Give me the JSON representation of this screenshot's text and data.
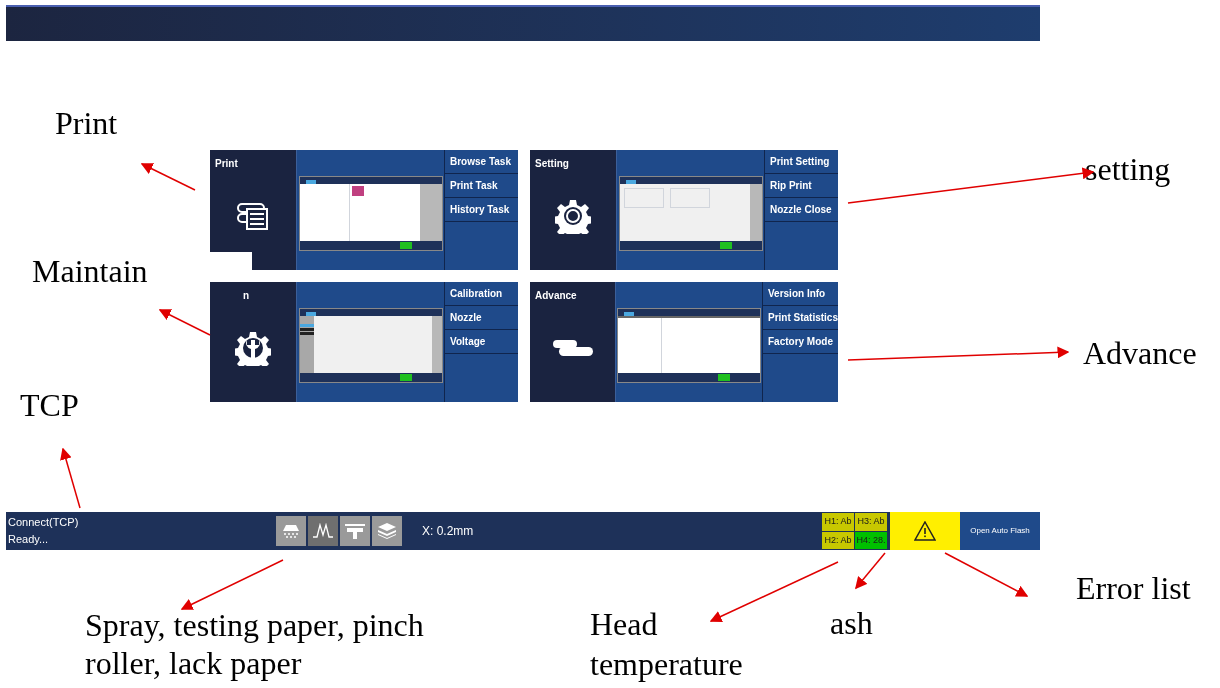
{
  "tiles": [
    {
      "title": "Print",
      "menu": [
        "Browse Task",
        "Print Task",
        "History Task"
      ]
    },
    {
      "title": "Setting",
      "menu": [
        "Print Setting",
        "Rip Print",
        "Nozzle Close"
      ]
    },
    {
      "title": "n",
      "menu": [
        "Calibration",
        "Nozzle",
        "Voltage"
      ]
    },
    {
      "title": "Advance",
      "menu": [
        "Version Info",
        "Print Statistics",
        "Factory Mode"
      ]
    }
  ],
  "status_bar": {
    "connection": "Connect(TCP)",
    "state": "Ready...",
    "sensors": [
      {
        "kind": "spray",
        "active": false
      },
      {
        "kind": "wave",
        "active": true
      },
      {
        "kind": "roller",
        "active": false
      },
      {
        "kind": "paper",
        "active": false
      }
    ],
    "position": "X: 0.2mm",
    "heads": [
      {
        "label": "H1: Ab",
        "color": "#c8c800"
      },
      {
        "label": "H2: Ab",
        "color": "#c8c800"
      },
      {
        "label": "H3: Ab",
        "color": "#c8c800"
      },
      {
        "label": "H4: 28.",
        "color": "#00c000"
      }
    ],
    "flash_button": "Open Auto Flash"
  },
  "annotations": [
    "Print",
    "setting",
    "Maintain",
    "Advance",
    "TCP",
    "Spray, testing paper, pinch roller, lack paper",
    "Head temperature",
    "ash",
    "Error list"
  ]
}
